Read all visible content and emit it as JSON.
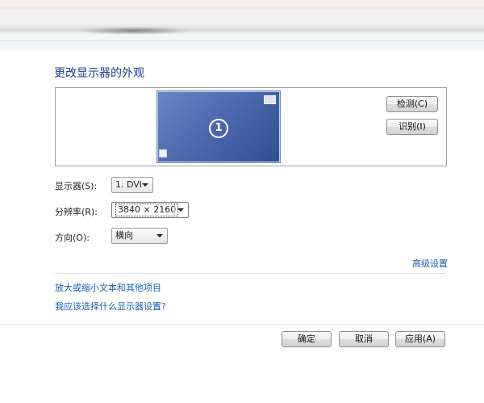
{
  "page": {
    "title": "更改显示器的外观"
  },
  "preview": {
    "monitor_number": "1",
    "detect_button": "检测(C)",
    "identify_button": "识别(I)"
  },
  "settings": {
    "display_label": "显示器(S):",
    "display_value": "1. DVI",
    "resolution_label": "分辨率(R):",
    "resolution_value": "3840 × 2160",
    "orientation_label": "方向(O):",
    "orientation_value": "横向"
  },
  "links": {
    "advanced": "高级设置",
    "text_size": "放大或缩小文本和其他项目",
    "which_settings": "我应该选择什么显示器设置?"
  },
  "footer": {
    "ok": "确定",
    "cancel": "取消",
    "apply": "应用(A)"
  }
}
